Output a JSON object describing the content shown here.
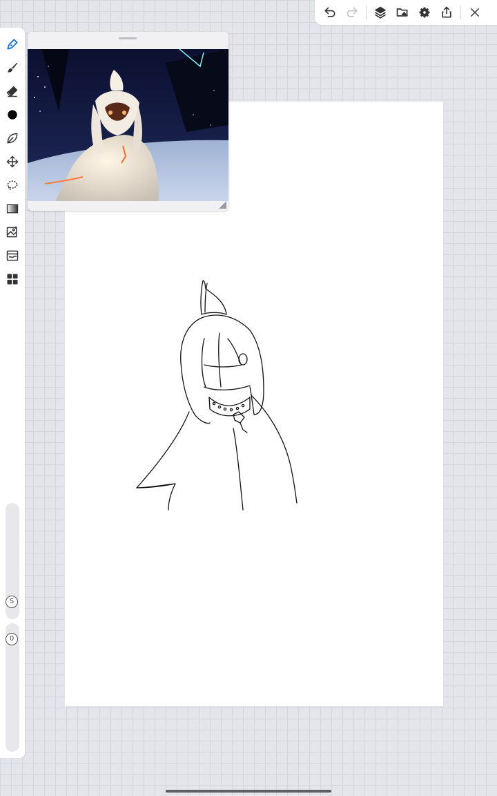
{
  "app": {
    "name": "drawing-canvas"
  },
  "topbar": {
    "buttons": [
      {
        "id": "undo",
        "icon": "undo-icon"
      },
      {
        "id": "redo",
        "icon": "redo-icon",
        "enabled": false
      },
      {
        "id": "layers",
        "icon": "layers-icon"
      },
      {
        "id": "gallery",
        "icon": "folder-image-icon"
      },
      {
        "id": "settings",
        "icon": "gear-icon"
      },
      {
        "id": "share",
        "icon": "share-icon"
      },
      {
        "id": "close",
        "icon": "close-icon"
      }
    ]
  },
  "toolbar": {
    "tools": [
      {
        "id": "pen",
        "icon": "pen-icon",
        "active": true
      },
      {
        "id": "brush",
        "icon": "brush-icon"
      },
      {
        "id": "eraser",
        "icon": "eraser-icon"
      },
      {
        "id": "color",
        "icon": "color-swatch",
        "color": "#000000"
      },
      {
        "id": "smudge",
        "icon": "leaf-blend-icon"
      },
      {
        "id": "move",
        "icon": "move-arrows-icon"
      },
      {
        "id": "lasso",
        "icon": "lasso-icon"
      },
      {
        "id": "fill",
        "icon": "gradient-fill-icon"
      },
      {
        "id": "image",
        "icon": "insert-image-icon"
      },
      {
        "id": "adjust",
        "icon": "image-adjust-icon"
      },
      {
        "id": "more",
        "icon": "grid-menu-icon"
      }
    ],
    "size_label": "S",
    "opacity_label": "0"
  },
  "reference_window": {
    "has_image": true
  },
  "colors": {
    "accent": "#1a73e8",
    "background": "#e4e5ea",
    "paper": "#ffffff"
  }
}
